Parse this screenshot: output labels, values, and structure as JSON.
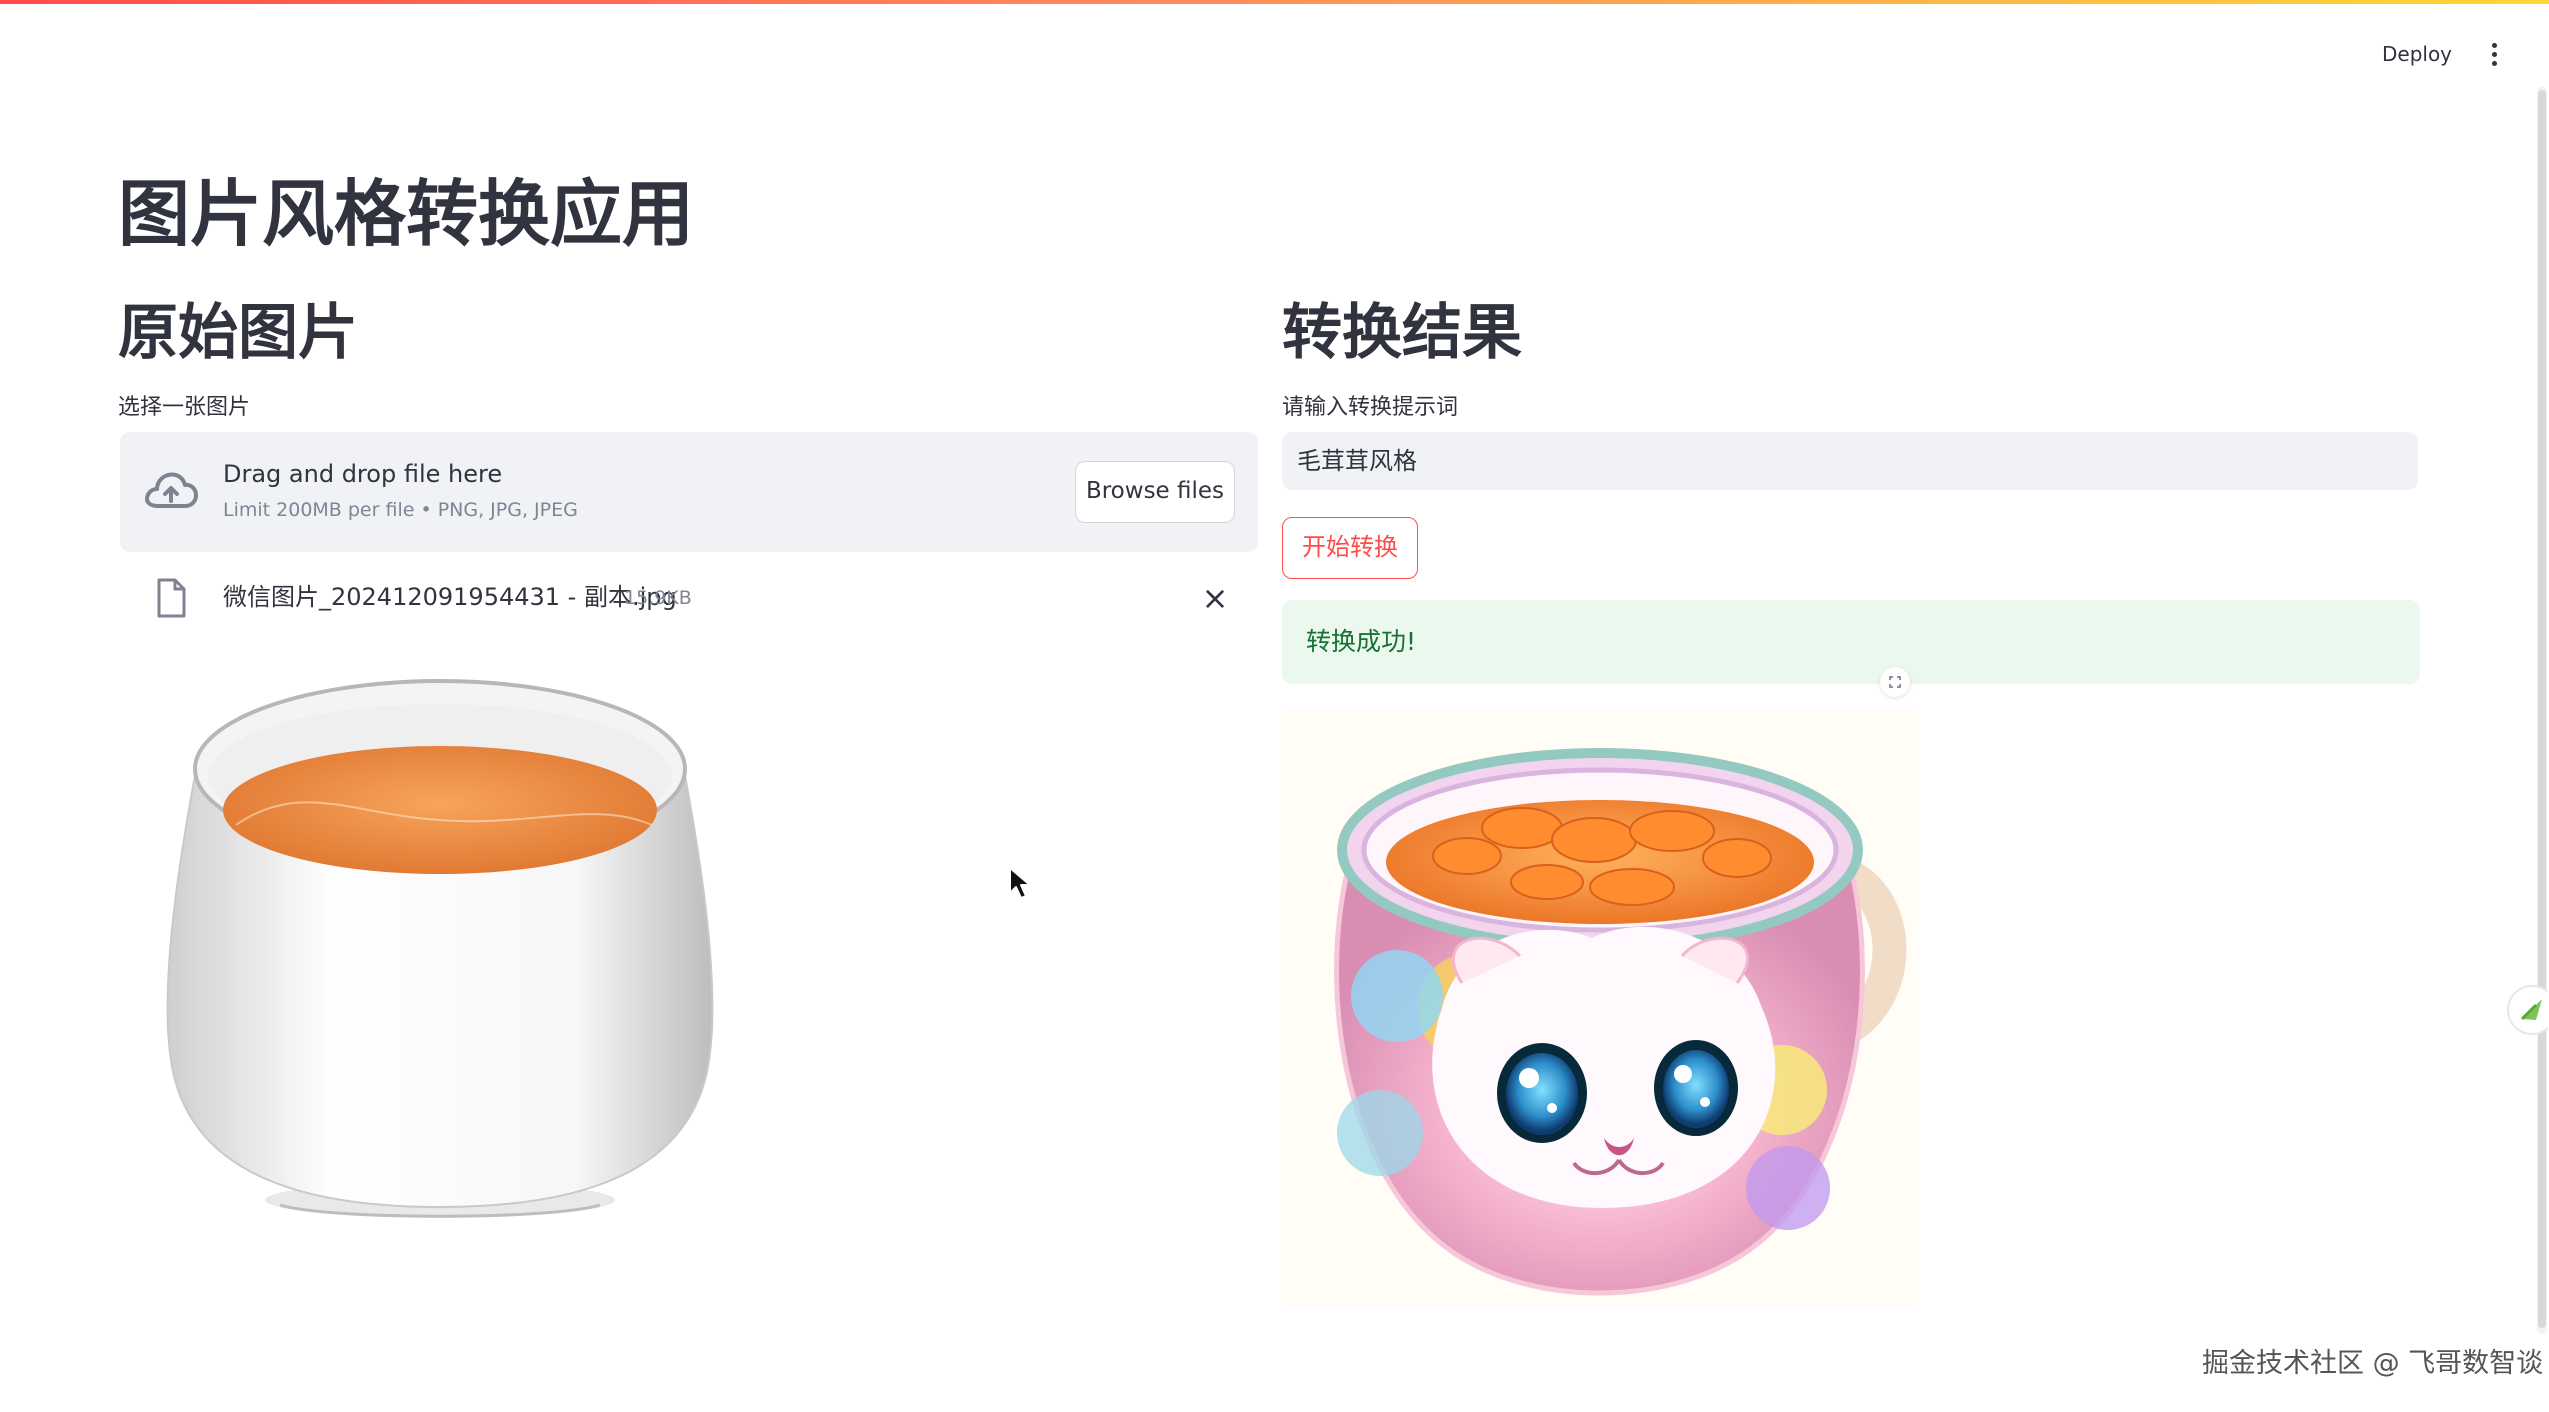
{
  "header": {
    "deploy_label": "Deploy",
    "menu_icon": "more-vertical-icon"
  },
  "page": {
    "title": "图片风格转换应用"
  },
  "left": {
    "title": "原始图片",
    "upload_label": "选择一张图片",
    "uploader": {
      "icon": "cloud-upload-icon",
      "drag_text": "Drag and drop file here",
      "limit_text": "Limit 200MB per file • PNG, JPG, JPEG",
      "browse_label": "Browse files"
    },
    "file": {
      "icon": "file-icon",
      "name": "微信图片_202412091954431 - 副本.jpg",
      "size": "15.9KB",
      "remove_icon": "close-icon"
    }
  },
  "right": {
    "title": "转换结果",
    "prompt_label": "请输入转换提示词",
    "prompt_value": "毛茸茸风格",
    "start_label": "开始转换",
    "success_text": "转换成功!"
  },
  "footer": {
    "watermark": "掘金技术社区 @ 飞哥数智谈"
  },
  "colors": {
    "accent": "#ff4b4b",
    "success_bg": "#eaf8ee",
    "success_text": "#177233",
    "input_bg": "#f0f2f6",
    "text": "#31333f"
  }
}
